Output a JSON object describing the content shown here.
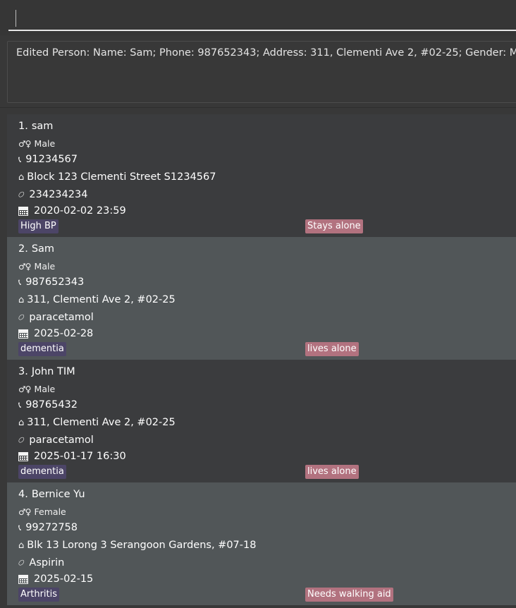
{
  "command": {
    "value": ""
  },
  "result": {
    "text": "Edited Person: Name: Sam; Phone: 987652343; Address: 311, Clementi Ave 2, #02-25; Gender: Male"
  },
  "persons": [
    {
      "index": "1.",
      "name": "sam",
      "gender": "Male",
      "phone": "91234567",
      "address": "Block 123 Clementi Street S1234567",
      "medication": "234234234",
      "appointment": "2020-02-02 23:59",
      "condition_tag": "High BP",
      "living_tag": "Stays alone"
    },
    {
      "index": "2.",
      "name": "Sam",
      "gender": "Male",
      "phone": "987652343",
      "address": "311, Clementi Ave 2, #02-25",
      "medication": "paracetamol",
      "appointment": "2025-02-28",
      "condition_tag": "dementia",
      "living_tag": "lives alone"
    },
    {
      "index": "3.",
      "name": "John TIM",
      "gender": "Male",
      "phone": "98765432",
      "address": "311, Clementi Ave 2, #02-25",
      "medication": "paracetamol",
      "appointment": "2025-01-17 16:30",
      "condition_tag": "dementia",
      "living_tag": "lives alone"
    },
    {
      "index": "4.",
      "name": "Bernice Yu",
      "gender": "Female",
      "phone": "99272758",
      "address": "Blk 13 Lorong 3 Serangoon Gardens, #07-18",
      "medication": "Aspirin",
      "appointment": "2025-02-15",
      "condition_tag": "Arthritis",
      "living_tag": "Needs walking aid"
    }
  ],
  "icons": {
    "gender": "gender-icon",
    "phone": "phone-icon",
    "address": "home-icon",
    "medication": "pill-icon",
    "appointment": "calendar-icon"
  },
  "colors": {
    "background": "#383838",
    "card_odd": "#3b3c3e",
    "card_even": "#515658",
    "condition_tag": "#4c4567",
    "living_tag": "#b2727f"
  }
}
